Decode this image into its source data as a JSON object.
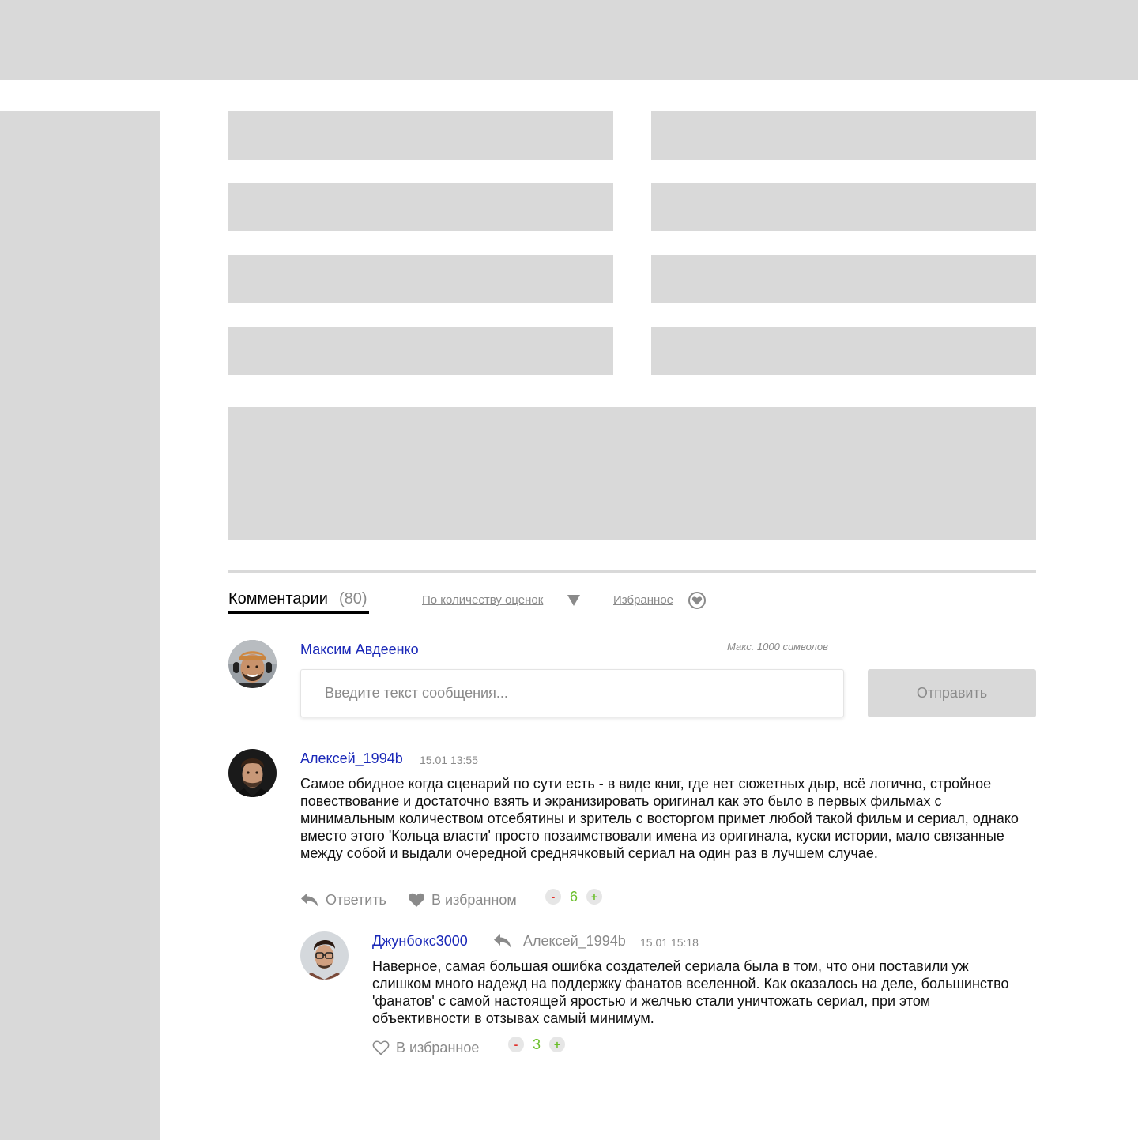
{
  "comments_section": {
    "tab_title": "Комментарии",
    "tab_count": "(80)",
    "sort_label": "По количеству оценок",
    "favorites_label": "Избранное"
  },
  "composer": {
    "user_name": "Максим Авдеенко",
    "max_chars": "Макс. 1000 символов",
    "placeholder": "Введите текст сообщения...",
    "send_label": "Отправить"
  },
  "comments": [
    {
      "author": "Алексей_1994b",
      "timestamp": "15.01 13:55",
      "text": "Самое обидное когда сценарий по сути есть - в виде книг, где нет сюжетных дыр, всё логично, стройное повествование и достаточно взять и экранизировать оригинал как это было в первых фильмах с минимальным количеством отсебятины и зритель с восторгом примет любой такой фильм и сериал, однако вместо этого 'Кольца власти' просто позаимствовали имена из оригинала, куски истории, мало связанные между собой и выдали очередной среднячковый сериал на один раз в лучшем случае.",
      "reply_label": "Ответить",
      "favorite_label": "В избранном",
      "favorited": true,
      "rating": "6",
      "minus_label": "-",
      "plus_label": "+"
    },
    {
      "author": "Джунбокс3000",
      "reply_to": "Алексей_1994b",
      "timestamp": "15.01 15:18",
      "text": "Наверное, самая большая ошибка создателей сериала была в том, что они поставили уж слишком много надежд на поддержку фанатов вселенной. Как оказалось на деле, большинство 'фанатов' с самой настоящей яростью и желчью стали уничтожать сериал, при этом объективности в отзывах самый минимум.",
      "favorite_label": "В избранное",
      "favorited": false,
      "rating": "3",
      "minus_label": "-",
      "plus_label": "+"
    }
  ],
  "colors": {
    "placeholder_gray": "#d9d9d9",
    "link_blue": "#1a28b8",
    "muted_text": "#8a8a8a",
    "vote_red": "#e0302b",
    "vote_green": "#6abf2a"
  }
}
